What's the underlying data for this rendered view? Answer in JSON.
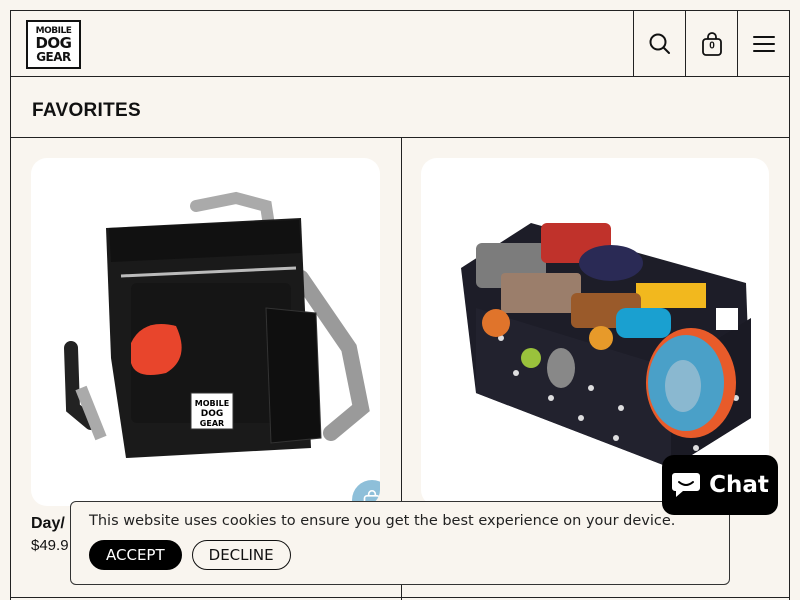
{
  "brand": {
    "logo_lines": [
      "MOBILE",
      "DOG",
      "GEAR"
    ]
  },
  "header": {
    "search_icon": "search-icon",
    "cart_icon": "shopping-bag-icon",
    "cart_count": "0",
    "menu_icon": "hamburger-menu-icon"
  },
  "section": {
    "title": "FAVORITES"
  },
  "products": [
    {
      "title": "Day/",
      "price": "$49.9",
      "image": "black shoulder bag with orange waste bag",
      "quick_add_icon": "shopping-bag-icon"
    },
    {
      "title": "",
      "price": "",
      "image": "black pawprint car organizer filled with dog toys"
    }
  ],
  "cookie": {
    "message": "This website uses cookies to ensure you get the best experience on your device.",
    "accept": "ACCEPT",
    "decline": "DECLINE"
  },
  "chat": {
    "label": "Chat",
    "icon": "chat-bubble-icon"
  },
  "colors": {
    "background": "#f9f5ef",
    "accent_blue": "#8ebfd9",
    "black": "#000000"
  }
}
